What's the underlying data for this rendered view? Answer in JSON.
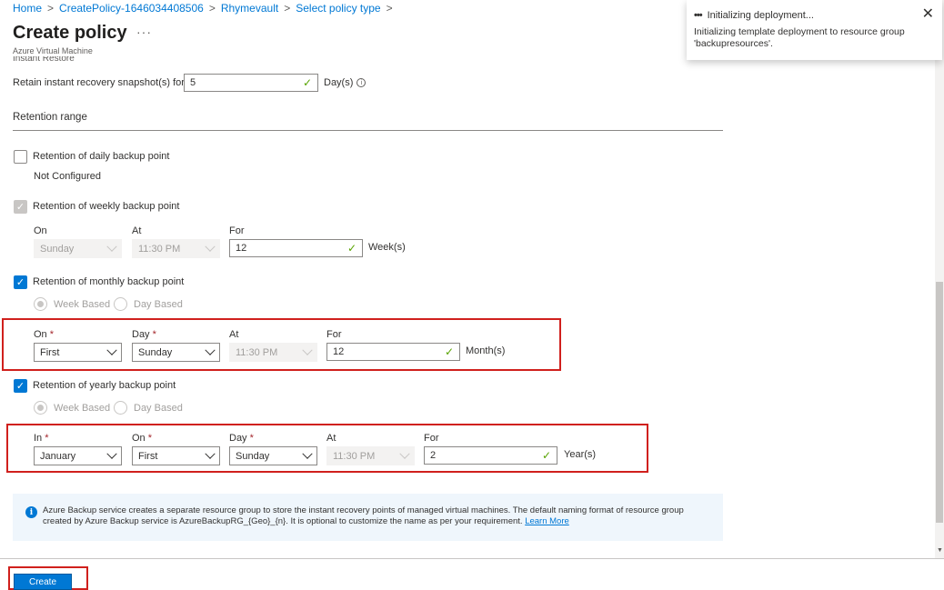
{
  "breadcrumb": {
    "items": [
      "Home",
      "CreatePolicy-1646034408506",
      "Rhymevault",
      "Select policy type"
    ],
    "separator": ">"
  },
  "page": {
    "title": "Create policy",
    "more_label": "···",
    "subtitle": "Azure Virtual Machine",
    "clipped_section": "Instant Restore"
  },
  "instant_restore": {
    "label": "Retain instant recovery snapshot(s) for",
    "value": "5",
    "unit": "Day(s)"
  },
  "retention_range": {
    "heading": "Retention range",
    "daily": {
      "label": "Retention of daily backup point",
      "checked": false,
      "status": "Not Configured"
    },
    "weekly": {
      "label": "Retention of weekly backup point",
      "on_label": "On",
      "at_label": "At",
      "for_label": "For",
      "on_value": "Sunday",
      "at_value": "11:30 PM",
      "for_value": "12",
      "unit": "Week(s)"
    },
    "monthly": {
      "label": "Retention of monthly backup point",
      "week_based": "Week Based",
      "day_based": "Day Based",
      "on_label": "On",
      "day_label": "Day",
      "at_label": "At",
      "for_label": "For",
      "required": "*",
      "on_value": "First",
      "day_value": "Sunday",
      "at_value": "11:30 PM",
      "for_value": "12",
      "unit": "Month(s)"
    },
    "yearly": {
      "label": "Retention of yearly backup point",
      "week_based": "Week Based",
      "day_based": "Day Based",
      "in_label": "In",
      "on_label": "On",
      "day_label": "Day",
      "at_label": "At",
      "for_label": "For",
      "required": "*",
      "in_value": "January",
      "on_value": "First",
      "day_value": "Sunday",
      "at_value": "11:30 PM",
      "for_value": "2",
      "unit": "Year(s)"
    }
  },
  "info_banner": {
    "text": "Azure Backup service creates a separate resource group to store the instant recovery points of managed virtual machines. The default naming format of resource group created by Azure Backup service is AzureBackupRG_{Geo}_{n}. It is optional to customize the name as per your requirement.",
    "link": "Learn More"
  },
  "footer": {
    "create_label": "Create"
  },
  "toast": {
    "title": "Initializing deployment...",
    "message": "Initializing template deployment to resource group 'backupresources'.",
    "close": "✕"
  },
  "colors": {
    "accent": "#0078d4",
    "highlight_box": "#d0201d",
    "valid_check": "#57a300",
    "required": "#a4262c"
  }
}
